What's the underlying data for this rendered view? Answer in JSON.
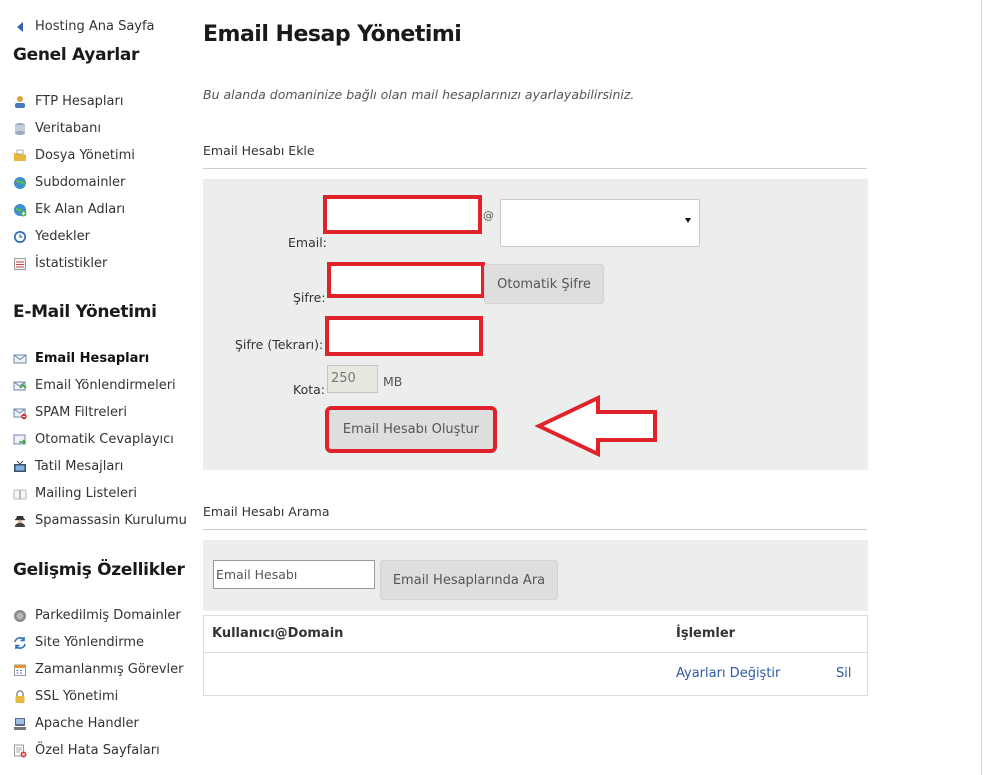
{
  "sidebar": {
    "back_label": "Hosting Ana Sayfa",
    "sections": [
      {
        "title": "Genel Ayarlar",
        "items": [
          {
            "label": "FTP Hesapları",
            "icon": "ftp-user-icon"
          },
          {
            "label": "Veritabanı",
            "icon": "database-icon"
          },
          {
            "label": "Dosya Yönetimi",
            "icon": "folder-icon"
          },
          {
            "label": "Subdomainler",
            "icon": "globe-icon"
          },
          {
            "label": "Ek Alan Adları",
            "icon": "globe-plus-icon"
          },
          {
            "label": "Yedekler",
            "icon": "clock-icon"
          },
          {
            "label": "İstatistikler",
            "icon": "stats-icon"
          }
        ]
      },
      {
        "title": "E-Mail Yönetimi",
        "items": [
          {
            "label": "Email Hesapları",
            "icon": "mail-icon",
            "active": true
          },
          {
            "label": "Email Yönlendirmeleri",
            "icon": "mail-forward-icon"
          },
          {
            "label": "SPAM Filtreleri",
            "icon": "spam-filter-icon"
          },
          {
            "label": "Otomatik Cevaplayıcı",
            "icon": "auto-reply-icon"
          },
          {
            "label": "Tatil Mesajları",
            "icon": "tv-icon"
          },
          {
            "label": "Mailing Listeleri",
            "icon": "book-icon"
          },
          {
            "label": "Spamassasin Kurulumu",
            "icon": "spy-icon"
          }
        ]
      },
      {
        "title": "Gelişmiş Özellikler",
        "items": [
          {
            "label": "Parkedilmiş Domainler",
            "icon": "parked-icon"
          },
          {
            "label": "Site Yönlendirme",
            "icon": "redirect-icon"
          },
          {
            "label": "Zamanlanmış Görevler",
            "icon": "calendar-icon"
          },
          {
            "label": "SSL Yönetimi",
            "icon": "lock-icon"
          },
          {
            "label": "Apache Handler",
            "icon": "server-icon"
          },
          {
            "label": "Özel Hata Sayfaları",
            "icon": "error-page-icon"
          }
        ]
      }
    ]
  },
  "main": {
    "title": "Email Hesap Yönetimi",
    "description": "Bu alanda domaninize bağlı olan mail hesaplarınızı ayarlayabilirsiniz.",
    "add_section": {
      "label": "Email Hesabı Ekle",
      "email_label": "Email:",
      "at_sign": "@",
      "password_label": "Şifre:",
      "auto_password_button": "Otomatik Şifre",
      "password_repeat_label": "Şifre (Tekrarı):",
      "quota_label": "Kota:",
      "quota_value": "250",
      "quota_unit": "MB",
      "create_button": "Email Hesabı Oluştur"
    },
    "search_section": {
      "label": "Email Hesabı Arama",
      "placeholder": "Email Hesabı",
      "search_button": "Email Hesaplarında Ara"
    },
    "table": {
      "columns": [
        "Kullanıcı@Domain",
        "İşlemler"
      ],
      "row_actions": [
        "Ayarları Değiştir",
        "Sil"
      ]
    }
  },
  "colors": {
    "highlight": "#e0222a",
    "panel_bg": "#eceeee",
    "link": "#2d5aa0"
  }
}
